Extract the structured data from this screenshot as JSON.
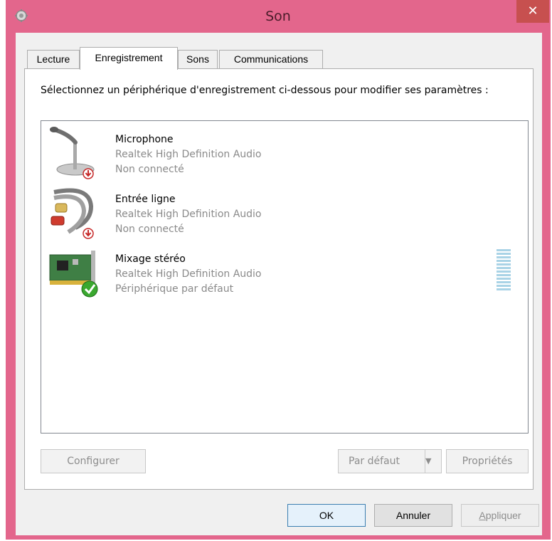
{
  "window": {
    "title": "Son",
    "close_glyph": "✕",
    "app_icon": "speaker-cog-icon"
  },
  "tabs": [
    {
      "label": "Lecture",
      "active": false
    },
    {
      "label": "Enregistrement",
      "active": true
    },
    {
      "label": "Sons",
      "active": false
    },
    {
      "label": "Communications",
      "active": false
    }
  ],
  "panel": {
    "instructions": "Sélectionnez un périphérique d'enregistrement ci-dessous pour modifier ses paramètres :"
  },
  "devices": [
    {
      "name": "Microphone",
      "driver": "Realtek High Definition Audio",
      "status": "Non connecté",
      "icon": "microphone-icon",
      "badge": "disconnected-badge-icon"
    },
    {
      "name": "Entrée ligne",
      "driver": "Realtek High Definition Audio",
      "status": "Non connecté",
      "icon": "line-in-cable-icon",
      "badge": "disconnected-badge-icon"
    },
    {
      "name": "Mixage stéréo",
      "driver": "Realtek High Definition Audio",
      "status": "Périphérique par défaut",
      "icon": "sound-card-icon",
      "badge": "default-check-icon"
    }
  ],
  "buttons": {
    "configure": "Configurer",
    "set_default": "Par défaut",
    "properties": "Propriétés",
    "ok": "OK",
    "cancel": "Annuler",
    "apply_first": "A",
    "apply_rest": "ppliquer"
  },
  "colors": {
    "frame": "#e3668c",
    "close": "#c7504f",
    "meter": "#a9d3e6",
    "check": "#3aa82f",
    "disconnected": "#c62828"
  }
}
